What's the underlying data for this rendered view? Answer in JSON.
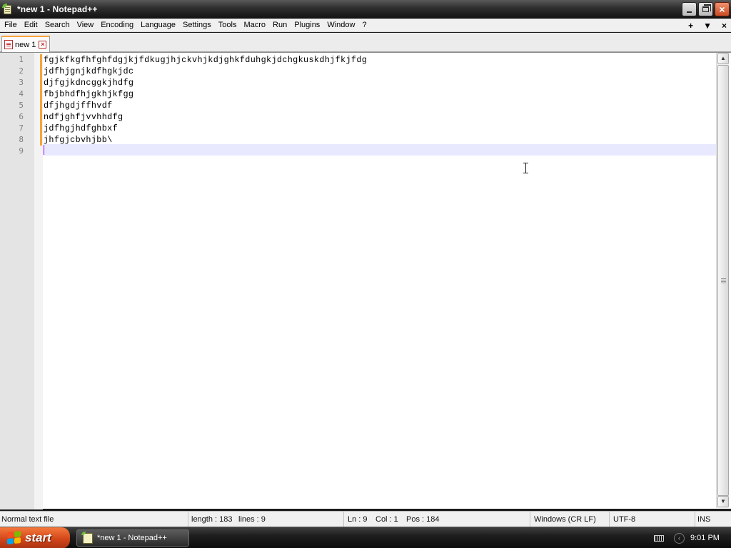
{
  "window": {
    "title": "*new 1 - Notepad++",
    "controls": {
      "minimize": "minimize",
      "restore": "restore",
      "close": "×"
    }
  },
  "menu": {
    "items": [
      "File",
      "Edit",
      "Search",
      "View",
      "Encoding",
      "Language",
      "Settings",
      "Tools",
      "Macro",
      "Run",
      "Plugins",
      "Window",
      "?"
    ],
    "right_controls": [
      "+",
      "▼",
      "×"
    ]
  },
  "tabs": [
    {
      "label": "new 1",
      "active": true,
      "modified": true
    }
  ],
  "editor": {
    "lines": [
      "fgjkfkgfhfghfdgjkjfdkugjhjckvhjkdjghkfduhgkjdchgkuskdhjfkjfdg",
      "jdfhjgnjkdfhgkjdc",
      "djfgjkdncggkjhdfg",
      "fbjbhdfhjgkhjkfgg",
      "dfjhgdjffhvdf",
      "ndfjghfjvvhhdfg",
      "jdfhgjhdfghbxf",
      "jhfgjcbvhjbb\\",
      ""
    ],
    "line_numbers": [
      "1",
      "2",
      "3",
      "4",
      "5",
      "6",
      "7",
      "8",
      "9"
    ],
    "caret_line": 9,
    "colors": {
      "caret_line_bg": "#e8e8ff",
      "change_marker": "#f7a43a",
      "caret": "#8000ff"
    }
  },
  "status": {
    "file_type": "Normal text file",
    "length": "length : 183",
    "lines": "lines : 9",
    "ln": "Ln : 9",
    "col": "Col : 1",
    "pos": "Pos : 184",
    "eol": "Windows (CR LF)",
    "encoding": "UTF-8",
    "mode": "INS"
  },
  "taskbar": {
    "start_label": "start",
    "task_label": "*new 1 - Notepad++",
    "clock": "9:01 PM",
    "tray_icons": [
      "keyboard-icon",
      "chevron-left-icon"
    ]
  }
}
